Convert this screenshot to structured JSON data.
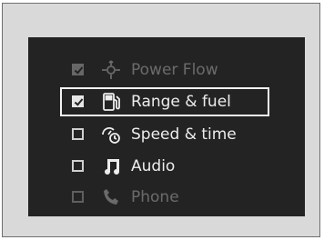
{
  "menu": {
    "items": [
      {
        "label": "Power Flow",
        "checked": true,
        "icon": "power-flow-icon",
        "state": "dimmed"
      },
      {
        "label": "Range & fuel",
        "checked": true,
        "icon": "fuel-pump-icon",
        "state": "selected"
      },
      {
        "label": "Speed & time",
        "checked": false,
        "icon": "speed-clock-icon",
        "state": "normal"
      },
      {
        "label": "Audio",
        "checked": false,
        "icon": "music-note-icon",
        "state": "normal"
      },
      {
        "label": "Phone",
        "checked": false,
        "icon": "phone-icon",
        "state": "partially-visible"
      }
    ]
  },
  "colors": {
    "frame": "#d9d9d9",
    "screen": "#232323",
    "text": "#ededed"
  }
}
